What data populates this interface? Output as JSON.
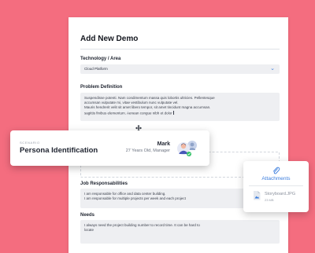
{
  "form": {
    "title": "Add New Demo",
    "technology_label": "Technology / Area",
    "technology_value": "Cloud Platform",
    "problem_label": "Problem Definition",
    "problem_lines": [
      "Suspendisse potenti. Nam condimentum massa quis lobortis ultricies. Pellentesque",
      "accumsan vulputate mi, vitae vestibulum nunc vulputate vel.",
      "Mauris hendrerit velit sit amet libero tempor, sit amet tincidunt magna accumsan.",
      "sagittis finibus elementum. Aenean congue nibh et dolor"
    ],
    "job_label": "Job Responsabilities",
    "job_lines": [
      "I am responsable for office and data center building.",
      "I am responsable for multiple projects per week and each project"
    ],
    "needs_label": "Needs",
    "needs_lines": [
      "I always need the project building number to record time. It can be hard to",
      "locate"
    ]
  },
  "persona": {
    "eyebrow": "SCENARIO",
    "title": "Persona Identification",
    "name": "Mark",
    "meta": "27 Years Old, Manager"
  },
  "attachments": {
    "title": "Attachments",
    "file_name": "Storyboard.JPG",
    "file_size": "23 MB"
  },
  "colors": {
    "background": "#f46d7f",
    "accent": "#3b7ddd",
    "field": "#eeeff2"
  }
}
